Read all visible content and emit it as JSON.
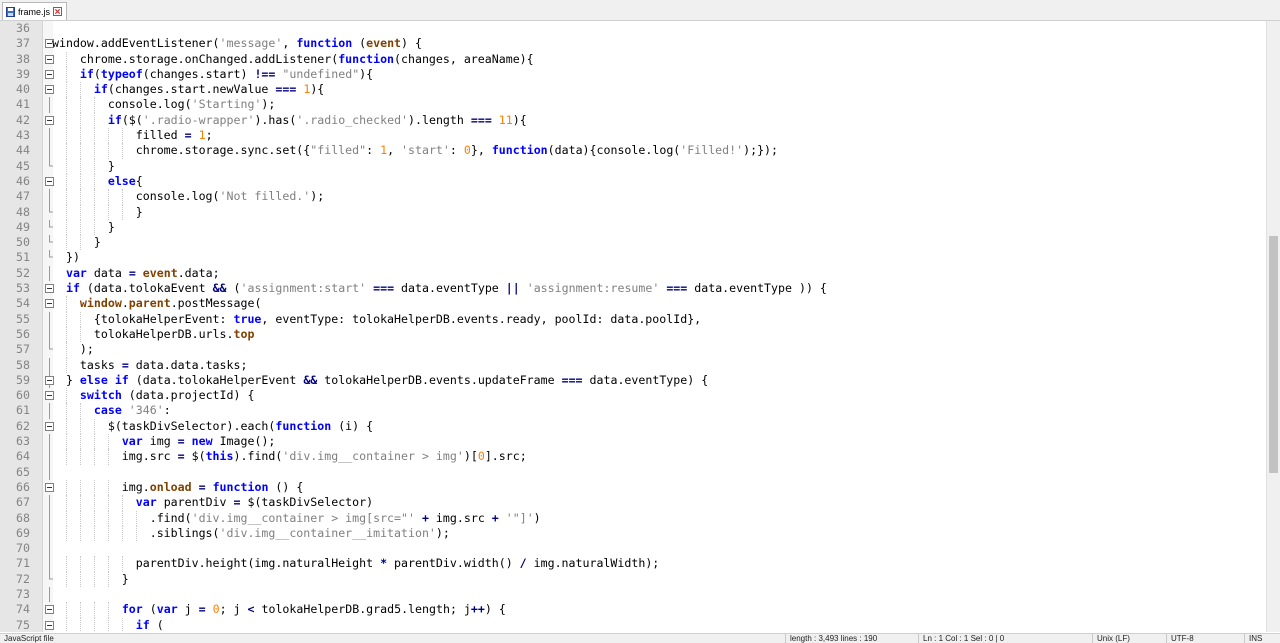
{
  "tab": {
    "filename": "frame.js",
    "icon": "save-disk-icon",
    "close_icon": "close-icon"
  },
  "lines": [
    {
      "n": "36",
      "t": []
    },
    {
      "n": "37",
      "fold": "open",
      "t": [
        [
          "id",
          "window.addEventListener("
        ],
        [
          "str",
          "'message'"
        ],
        [
          "id",
          ", "
        ],
        [
          "kw",
          "function"
        ],
        [
          "id",
          " ("
        ],
        [
          "cls",
          "event"
        ],
        [
          "id",
          ") {"
        ]
      ]
    },
    {
      "n": "38",
      "fold": "open",
      "t": [
        [
          "id",
          "    chrome.storage.onChanged.addListener("
        ],
        [
          "kw",
          "function"
        ],
        [
          "id",
          "(changes, areaName){"
        ]
      ]
    },
    {
      "n": "39",
      "fold": "open",
      "t": [
        [
          "id",
          "    "
        ],
        [
          "kw",
          "if"
        ],
        [
          "id",
          "("
        ],
        [
          "kw",
          "typeof"
        ],
        [
          "id",
          "(changes.start) "
        ],
        [
          "op",
          "!=="
        ],
        [
          "id",
          " "
        ],
        [
          "str",
          "\"undefined\""
        ],
        [
          "id",
          "){"
        ]
      ]
    },
    {
      "n": "40",
      "fold": "open",
      "t": [
        [
          "id",
          "      "
        ],
        [
          "kw",
          "if"
        ],
        [
          "id",
          "(changes.start.newValue "
        ],
        [
          "op",
          "==="
        ],
        [
          "id",
          " "
        ],
        [
          "num",
          "1"
        ],
        [
          "id",
          "){"
        ]
      ]
    },
    {
      "n": "41",
      "t": [
        [
          "id",
          "        console.log("
        ],
        [
          "str",
          "'Starting'"
        ],
        [
          "id",
          ");"
        ]
      ]
    },
    {
      "n": "42",
      "fold": "open",
      "t": [
        [
          "id",
          "        "
        ],
        [
          "kw",
          "if"
        ],
        [
          "id",
          "($("
        ],
        [
          "str",
          "'.radio-wrapper'"
        ],
        [
          "id",
          ").has("
        ],
        [
          "str",
          "'.radio_checked'"
        ],
        [
          "id",
          ").length "
        ],
        [
          "op",
          "==="
        ],
        [
          "id",
          " "
        ],
        [
          "num",
          "11"
        ],
        [
          "id",
          "){"
        ]
      ]
    },
    {
      "n": "43",
      "t": [
        [
          "id",
          "            filled "
        ],
        [
          "op",
          "="
        ],
        [
          "id",
          " "
        ],
        [
          "num",
          "1"
        ],
        [
          "id",
          ";"
        ]
      ]
    },
    {
      "n": "44",
      "t": [
        [
          "id",
          "            chrome.storage.sync.set({"
        ],
        [
          "str",
          "\"filled\""
        ],
        [
          "id",
          ": "
        ],
        [
          "num",
          "1"
        ],
        [
          "id",
          ", "
        ],
        [
          "str",
          "'start'"
        ],
        [
          "id",
          ": "
        ],
        [
          "num",
          "0"
        ],
        [
          "id",
          "}, "
        ],
        [
          "kw",
          "function"
        ],
        [
          "id",
          "(data){console.log("
        ],
        [
          "str",
          "'Filled!'"
        ],
        [
          "id",
          ");});"
        ]
      ]
    },
    {
      "n": "45",
      "fold": "end",
      "t": [
        [
          "id",
          "        }"
        ]
      ]
    },
    {
      "n": "46",
      "fold": "open",
      "t": [
        [
          "id",
          "        "
        ],
        [
          "kw",
          "else"
        ],
        [
          "id",
          "{"
        ]
      ]
    },
    {
      "n": "47",
      "t": [
        [
          "id",
          "            console.log("
        ],
        [
          "str",
          "'Not filled.'"
        ],
        [
          "id",
          ");"
        ]
      ]
    },
    {
      "n": "48",
      "fold": "end",
      "t": [
        [
          "id",
          "            }"
        ]
      ]
    },
    {
      "n": "49",
      "fold": "end",
      "t": [
        [
          "id",
          "        }"
        ]
      ]
    },
    {
      "n": "50",
      "fold": "end",
      "t": [
        [
          "id",
          "      }"
        ]
      ]
    },
    {
      "n": "51",
      "fold": "end",
      "t": [
        [
          "id",
          "  })"
        ]
      ]
    },
    {
      "n": "52",
      "t": [
        [
          "id",
          "  "
        ],
        [
          "kw",
          "var"
        ],
        [
          "id",
          " data "
        ],
        [
          "op",
          "="
        ],
        [
          "id",
          " "
        ],
        [
          "cls",
          "event"
        ],
        [
          "id",
          ".data;"
        ]
      ]
    },
    {
      "n": "53",
      "fold": "open",
      "t": [
        [
          "id",
          "  "
        ],
        [
          "kw",
          "if"
        ],
        [
          "id",
          " (data.tolokaEvent "
        ],
        [
          "op",
          "&&"
        ],
        [
          "id",
          " ("
        ],
        [
          "str",
          "'assignment:start'"
        ],
        [
          "id",
          " "
        ],
        [
          "op",
          "==="
        ],
        [
          "id",
          " data.eventType "
        ],
        [
          "op",
          "||"
        ],
        [
          "id",
          " "
        ],
        [
          "str",
          "'assignment:resume'"
        ],
        [
          "id",
          " "
        ],
        [
          "op",
          "==="
        ],
        [
          "id",
          " data.eventType )) {"
        ]
      ]
    },
    {
      "n": "54",
      "fold": "open",
      "t": [
        [
          "id",
          "    "
        ],
        [
          "cls",
          "window"
        ],
        [
          "id",
          "."
        ],
        [
          "cls",
          "parent"
        ],
        [
          "id",
          ".postMessage("
        ]
      ]
    },
    {
      "n": "55",
      "t": [
        [
          "id",
          "      {tolokaHelperEvent: "
        ],
        [
          "kw",
          "true"
        ],
        [
          "id",
          ", eventType: tolokaHelperDB.events.ready, poolId: data.poolId},"
        ]
      ]
    },
    {
      "n": "56",
      "t": [
        [
          "id",
          "      tolokaHelperDB.urls."
        ],
        [
          "cls",
          "top"
        ]
      ]
    },
    {
      "n": "57",
      "fold": "end",
      "t": [
        [
          "id",
          "    );"
        ]
      ]
    },
    {
      "n": "58",
      "t": [
        [
          "id",
          "    tasks "
        ],
        [
          "op",
          "="
        ],
        [
          "id",
          " data.data.tasks;"
        ]
      ]
    },
    {
      "n": "59",
      "fold": "mid",
      "t": [
        [
          "id",
          "  } "
        ],
        [
          "kw",
          "else if"
        ],
        [
          "id",
          " (data.tolokaHelperEvent "
        ],
        [
          "op",
          "&&"
        ],
        [
          "id",
          " tolokaHelperDB.events.updateFrame "
        ],
        [
          "op",
          "==="
        ],
        [
          "id",
          " data.eventType) {"
        ]
      ]
    },
    {
      "n": "60",
      "fold": "open",
      "t": [
        [
          "id",
          "    "
        ],
        [
          "kw",
          "switch"
        ],
        [
          "id",
          " (data.projectId) {"
        ]
      ]
    },
    {
      "n": "61",
      "t": [
        [
          "id",
          "      "
        ],
        [
          "kw",
          "case"
        ],
        [
          "id",
          " "
        ],
        [
          "str",
          "'346'"
        ],
        [
          "id",
          ":"
        ]
      ]
    },
    {
      "n": "62",
      "fold": "open",
      "t": [
        [
          "id",
          "        $(taskDivSelector).each("
        ],
        [
          "kw",
          "function"
        ],
        [
          "id",
          " (i) {"
        ]
      ]
    },
    {
      "n": "63",
      "t": [
        [
          "id",
          "          "
        ],
        [
          "kw",
          "var"
        ],
        [
          "id",
          " img "
        ],
        [
          "op",
          "="
        ],
        [
          "id",
          " "
        ],
        [
          "kw",
          "new"
        ],
        [
          "id",
          " Image();"
        ]
      ]
    },
    {
      "n": "64",
      "t": [
        [
          "id",
          "          img.src "
        ],
        [
          "op",
          "="
        ],
        [
          "id",
          " $("
        ],
        [
          "kw",
          "this"
        ],
        [
          "id",
          ").find("
        ],
        [
          "str",
          "'div.img__container > img'"
        ],
        [
          "id",
          ")["
        ],
        [
          "num",
          "0"
        ],
        [
          "id",
          "].src;"
        ]
      ]
    },
    {
      "n": "65",
      "t": []
    },
    {
      "n": "66",
      "fold": "open",
      "t": [
        [
          "id",
          "          img."
        ],
        [
          "cls",
          "onload"
        ],
        [
          "id",
          " "
        ],
        [
          "op",
          "="
        ],
        [
          "id",
          " "
        ],
        [
          "kw",
          "function"
        ],
        [
          "id",
          " () {"
        ]
      ]
    },
    {
      "n": "67",
      "t": [
        [
          "id",
          "            "
        ],
        [
          "kw",
          "var"
        ],
        [
          "id",
          " parentDiv "
        ],
        [
          "op",
          "="
        ],
        [
          "id",
          " $(taskDivSelector)"
        ]
      ]
    },
    {
      "n": "68",
      "t": [
        [
          "id",
          "              .find("
        ],
        [
          "str",
          "'div.img__container > img[src=\"'"
        ],
        [
          "id",
          " "
        ],
        [
          "op",
          "+"
        ],
        [
          "id",
          " img.src "
        ],
        [
          "op",
          "+"
        ],
        [
          "id",
          " "
        ],
        [
          "str",
          "'\"]'"
        ],
        [
          "id",
          ")"
        ]
      ]
    },
    {
      "n": "69",
      "t": [
        [
          "id",
          "              .siblings("
        ],
        [
          "str",
          "'div.img__container__imitation'"
        ],
        [
          "id",
          ");"
        ]
      ]
    },
    {
      "n": "70",
      "t": []
    },
    {
      "n": "71",
      "t": [
        [
          "id",
          "            parentDiv.height(img.naturalHeight "
        ],
        [
          "op",
          "*"
        ],
        [
          "id",
          " parentDiv.width() "
        ],
        [
          "op",
          "/"
        ],
        [
          "id",
          " img.naturalWidth);"
        ]
      ]
    },
    {
      "n": "72",
      "fold": "end",
      "t": [
        [
          "id",
          "          }"
        ]
      ]
    },
    {
      "n": "73",
      "t": []
    },
    {
      "n": "74",
      "fold": "open",
      "t": [
        [
          "id",
          "          "
        ],
        [
          "kw",
          "for"
        ],
        [
          "id",
          " ("
        ],
        [
          "kw",
          "var"
        ],
        [
          "id",
          " j "
        ],
        [
          "op",
          "="
        ],
        [
          "id",
          " "
        ],
        [
          "num",
          "0"
        ],
        [
          "id",
          "; j "
        ],
        [
          "op",
          "<"
        ],
        [
          "id",
          " tolokaHelperDB.grad5.length; j"
        ],
        [
          "op",
          "++"
        ],
        [
          "id",
          ") {"
        ]
      ]
    },
    {
      "n": "75",
      "fold": "open",
      "t": [
        [
          "id",
          "            "
        ],
        [
          "kw",
          "if"
        ],
        [
          "id",
          " ("
        ]
      ]
    }
  ],
  "status": {
    "file_type": "JavaScript file",
    "length": "length : 3,493    lines : 190",
    "position": "Ln : 1    Col : 1    Sel : 0 | 0",
    "eol": "Unix (LF)",
    "encoding": "UTF-8",
    "mode": "INS"
  }
}
